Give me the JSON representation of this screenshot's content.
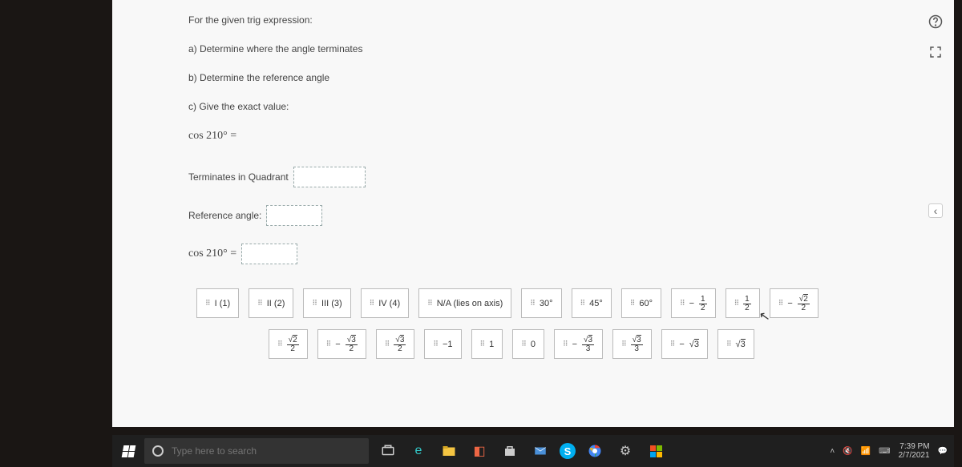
{
  "question": {
    "prompt": "For the given trig expression:",
    "part_a": "a) Determine where the angle terminates",
    "part_b": "b) Determine the reference angle",
    "part_c": "c) Give the exact value:",
    "expr_label": "cos 210° =",
    "quadrant_label": "Terminates in Quadrant",
    "ref_label": "Reference angle:",
    "expr2_label": "cos 210° ="
  },
  "tiles_row1": [
    {
      "text": "I (1)"
    },
    {
      "text": "II (2)"
    },
    {
      "text": "III (3)"
    },
    {
      "text": "IV (4)"
    },
    {
      "text": "N/A (lies on axis)"
    },
    {
      "text": "30°"
    },
    {
      "text": "45°"
    },
    {
      "text": "60°"
    },
    {
      "frac_num": "1",
      "frac_den": "2",
      "neg": true
    },
    {
      "frac_num": "1",
      "frac_den": "2"
    },
    {
      "frac_num_sqrt": "2",
      "frac_den": "2",
      "neg": true
    }
  ],
  "tiles_row2": [
    {
      "frac_num_sqrt": "2",
      "frac_den": "2"
    },
    {
      "frac_num_sqrt": "3",
      "frac_den": "2",
      "neg": true
    },
    {
      "frac_num_sqrt": "3",
      "frac_den": "2"
    },
    {
      "text": "−1"
    },
    {
      "text": "1"
    },
    {
      "text": "0"
    },
    {
      "frac_num_sqrt": "3",
      "frac_den": "3",
      "neg": true
    },
    {
      "frac_num_sqrt": "3",
      "frac_den": "3"
    },
    {
      "sqrt": "3",
      "neg": true
    },
    {
      "sqrt": "3"
    }
  ],
  "taskbar": {
    "search_placeholder": "Type here to search",
    "time": "7:39 PM",
    "date": "2/7/2021"
  },
  "side": {
    "help": "?",
    "fullscreen": "⛶",
    "collapse": "‹"
  }
}
